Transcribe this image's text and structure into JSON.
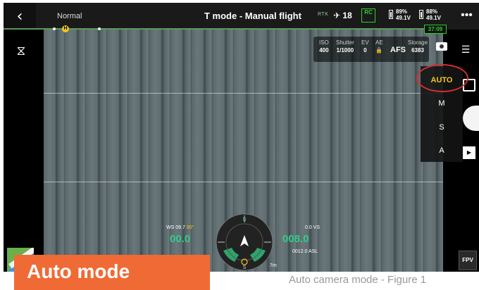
{
  "topbar": {
    "back_icon": "chevron-left-icon",
    "flight_mode": "Normal",
    "title": "T mode - Manual flight",
    "rtk_label": "RTK",
    "satellite_count": "18",
    "rc_label": "RC",
    "battery1": {
      "percent": "89%",
      "voltage": "49.1V"
    },
    "battery2": {
      "percent": "88%",
      "voltage": "49.1V"
    },
    "more_label": "•••",
    "timer": "37:09",
    "home_marker": "H"
  },
  "camera_params": {
    "iso_label": "ISO",
    "iso_value": "400",
    "shutter_label": "Shutter",
    "shutter_value": "1/1000",
    "ev_label": "EV",
    "ev_value": "0",
    "ae_label": "AE",
    "focus": "AFS",
    "storage_label": "Storage",
    "storage_value": "6383"
  },
  "mode_menu": {
    "items": [
      {
        "label": "AUTO",
        "active": true
      },
      {
        "label": "M",
        "active": false
      },
      {
        "label": "S",
        "active": false
      },
      {
        "label": "A",
        "active": false
      }
    ]
  },
  "telemetry": {
    "ws": "WS 09.7",
    "wind_dir": "90°",
    "horizontal_speed": "00.0",
    "vs_label": "0.0 VS",
    "altitude": "008.0",
    "asl": "0012.0 ASL",
    "distance": "7m",
    "compass_n": "N",
    "compass_s": "S"
  },
  "right_controls": {
    "fpv_label": "FPV"
  },
  "banner": {
    "label": "Auto mode"
  },
  "caption": {
    "text": "Auto camera mode - Figure 1"
  },
  "colors": {
    "accent_yellow": "#f5c518",
    "highlight_red": "#d32f2f",
    "telemetry_green": "#33cc88",
    "banner_orange": "#f06a35"
  }
}
